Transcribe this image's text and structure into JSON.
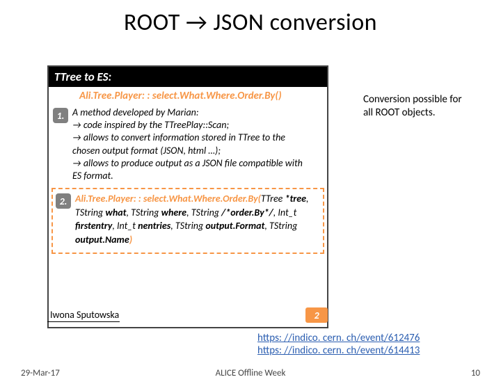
{
  "title": "ROOT → JSON conversion",
  "box": {
    "header": "TTree to ES:",
    "subheader": "Ali.Tree.Player: : select.What.Where.Order.By()",
    "step1": {
      "num": "1.",
      "l1": "A method developed by Marian:",
      "l2": "→ code inspired by the TTreePlay::Scan;",
      "l3": "→ allows to convert information stored in TTree to the",
      "l4": "chosen output format (JSON, html …);",
      "l5": "→ allows to produce output as a JSON file compatible with",
      "l6": "ES format."
    },
    "step2": {
      "num": "2.",
      "lead": "Ali.Tree.Player: : select.What.Where.Order.By(",
      "t1": "TTree ",
      "t1b": "*tree",
      "c1": ",",
      "l2a": "TString ",
      "l2b": "what",
      "c2": ", TString ",
      "l2c": "where",
      "c3": ", TString ",
      "l2d": "/*order.By*/",
      "c4": ",  Int_t",
      "l3a": "firstentry",
      "c5": ",  Int_t ",
      "l3b": "nentries",
      "c6": ",  TString ",
      "l3c": "output.Format",
      "c7": ", TString",
      "l4a": "output.Name",
      "close": ")"
    },
    "corner_badge": "2"
  },
  "attribution": "Iwona Sputowska",
  "note": {
    "l1": "Conversion possible for",
    "l2": "all ROOT objects."
  },
  "links": {
    "l1": "https: //indico. cern. ch/event/612476",
    "l2": "https: //indico. cern. ch/event/614413"
  },
  "footer": {
    "date": "29-Mar-17",
    "mid": "ALICE Offline Week",
    "page": "10"
  }
}
